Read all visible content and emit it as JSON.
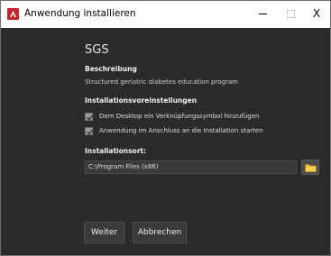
{
  "window": {
    "title": "Anwendung installieren",
    "controls": {
      "minimize": "–",
      "maximize": "□",
      "close": "X"
    }
  },
  "app": {
    "name": "SGS"
  },
  "description": {
    "label": "Beschreibung",
    "text": "Structured geriatric diabetes education program"
  },
  "preferences": {
    "label": "Installationsvoreinstellungen",
    "options": [
      {
        "label": "Dem Desktop ein Verknüpfungssymbol hinzufügen",
        "checked": true
      },
      {
        "label": "Anwendung im Anschluss an die Installation starten",
        "checked": true
      }
    ]
  },
  "location": {
    "label": "Installationsort:",
    "path": "C:\\Program Files (x86)",
    "browse_icon": "folder-icon"
  },
  "buttons": {
    "next": "Weiter",
    "cancel": "Abbrechen"
  },
  "colors": {
    "background": "#2b2b2b",
    "accent": "#c1272d",
    "folder": "#e8b830"
  }
}
